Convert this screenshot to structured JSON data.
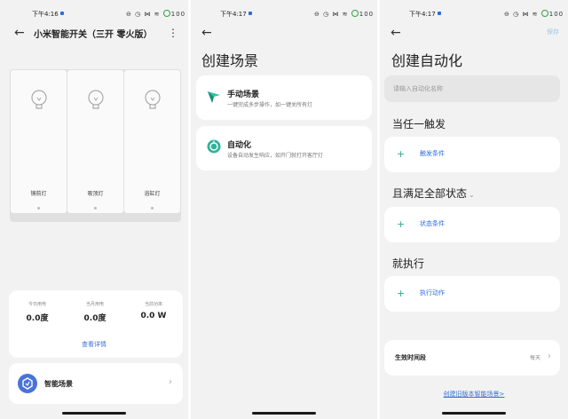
{
  "screen1": {
    "status": {
      "time": "下午4:16",
      "icons": "⊖ ◷ ⋈ ≋",
      "battery": "100"
    },
    "title": "小米智能开关（三开 零火版）",
    "switches": [
      {
        "label": "镜前灯"
      },
      {
        "label": "吸顶灯"
      },
      {
        "label": "浴缸灯"
      }
    ],
    "stats": [
      {
        "label": "今日用电",
        "value": "0.0度"
      },
      {
        "label": "当月用电",
        "value": "0.0度"
      },
      {
        "label": "当前功率",
        "value": "0.0 W"
      }
    ],
    "detail_link": "查看详情",
    "scene_label": "智能场景"
  },
  "screen2": {
    "status": {
      "time": "下午4:17",
      "icons": "⊖ ◷ ⋈ ≋",
      "battery": "100"
    },
    "title": "创建场景",
    "options": [
      {
        "title": "手动场景",
        "subtitle": "一键完成多步操作，如一键关所有灯"
      },
      {
        "title": "自动化",
        "subtitle": "设备自动发生响应，如开门就打开客厅灯"
      }
    ]
  },
  "screen3": {
    "status": {
      "time": "下午4:17",
      "icons": "⊖ ◷ ⋈ ≋",
      "battery": "100"
    },
    "save_label": "保存",
    "title": "创建自动化",
    "name_placeholder": "请输入自动化名称",
    "trigger_section": "当任一触发",
    "trigger_add": "触发条件",
    "condition_section": "且满足全部状态",
    "condition_add": "状态条件",
    "action_section": "就执行",
    "action_add": "执行动作",
    "time_label": "生效时间段",
    "time_value": "每天",
    "legacy_link": "创建旧版本智能场景>"
  },
  "colors": {
    "accent_blue": "#3b6fd6",
    "accent_teal": "#2fa88f",
    "scene_icon": "#4a73d8"
  }
}
